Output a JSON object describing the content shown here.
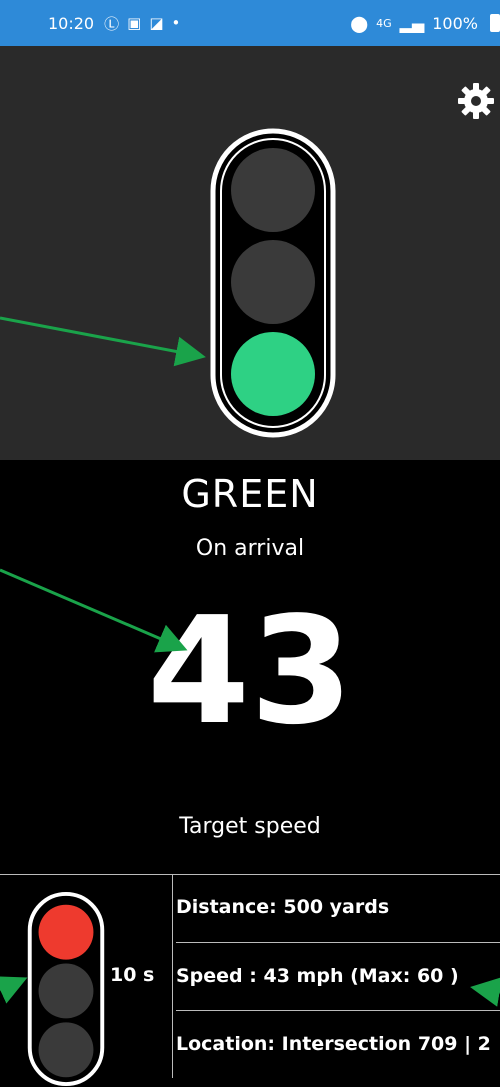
{
  "status_bar": {
    "time": "10:20",
    "network": "4G",
    "battery": "100%"
  },
  "colors": {
    "status_bar": "#2e8ad8",
    "green_light": "#2ed184",
    "red_light": "#ee3a2e",
    "off_light": "#3a3a3a",
    "annotation_arrow": "#1aa34a"
  },
  "icons": [
    "location-icon",
    "signal-icon",
    "battery-icon",
    "gear-icon"
  ],
  "signal": {
    "state": "GREEN",
    "subtitle": "On arrival"
  },
  "speed": {
    "value": "43",
    "label": "Target speed"
  },
  "bottom": {
    "countdown": "10 s",
    "distance": "Distance: 500 yards",
    "speed": "Speed : 43 mph (Max: 60 )",
    "location": "Location: Intersection 709 | 2"
  }
}
